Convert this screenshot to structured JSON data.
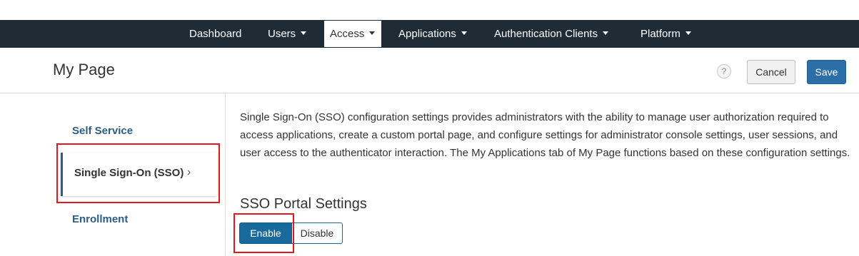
{
  "nav": {
    "items": [
      {
        "label": "Dashboard",
        "dropdown": false
      },
      {
        "label": "Users",
        "dropdown": true
      },
      {
        "label": "Access",
        "dropdown": true,
        "active": true
      },
      {
        "label": "Applications",
        "dropdown": true
      },
      {
        "label": "Authentication Clients",
        "dropdown": true
      },
      {
        "label": "Platform",
        "dropdown": true
      }
    ]
  },
  "header": {
    "title": "My Page",
    "help_glyph": "?",
    "cancel_label": "Cancel",
    "save_label": "Save"
  },
  "sidebar": {
    "items": [
      {
        "label": "Self Service"
      },
      {
        "label": "Single Sign-On (SSO)",
        "active": true
      },
      {
        "label": "Enrollment"
      }
    ],
    "chevron_glyph": "›"
  },
  "main": {
    "description": "Single Sign-On (SSO) configuration settings provides administrators with the ability to manage user authorization required to access applications, create a custom portal page, and configure settings for administrator console settings, user sessions, and user access to the authenticator interaction. The My Applications tab of My Page functions based on these configuration settings.",
    "section_title": "SSO Portal Settings",
    "toggle": {
      "enable_label": "Enable",
      "disable_label": "Disable",
      "selected": "Enable"
    }
  },
  "colors": {
    "topbar": "#1f2b35",
    "primary": "#2b6ea8",
    "highlight": "#e3181f",
    "link": "#2d5c85"
  }
}
